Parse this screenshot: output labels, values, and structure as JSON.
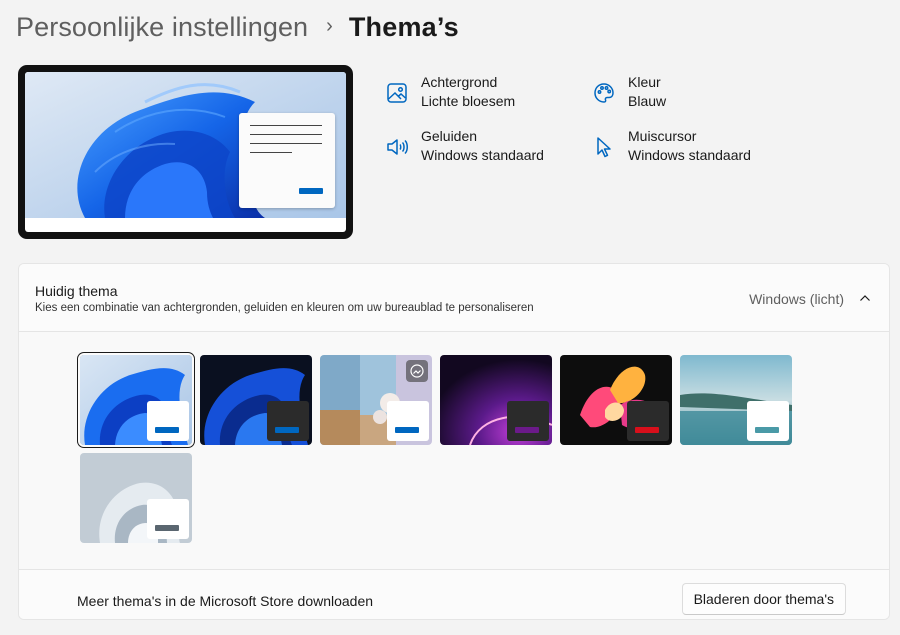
{
  "breadcrumb": {
    "parent": "Persoonlijke instellingen",
    "separator": "›",
    "current": "Thema’s"
  },
  "properties": {
    "background": {
      "title": "Achtergrond",
      "value": "Lichte bloesem",
      "icon": "image-icon"
    },
    "color": {
      "title": "Kleur",
      "value": "Blauw",
      "icon": "palette-icon"
    },
    "sounds": {
      "title": "Geluiden",
      "value": "Windows standaard",
      "icon": "speaker-icon"
    },
    "cursor": {
      "title": "Muiscursor",
      "value": "Windows standaard",
      "icon": "mouse-pointer-icon"
    }
  },
  "current_theme": {
    "title": "Huidig thema",
    "description": "Kies een combinatie van achtergronden, geluiden en kleuren om uw bureaublad te personaliseren",
    "value": "Windows (licht)",
    "expanded": true
  },
  "themes": [
    {
      "id": "windows-light",
      "selected": true,
      "window_color": "#ffffff",
      "button_color": "#0067c0"
    },
    {
      "id": "windows-dark",
      "selected": false,
      "window_color": "#2b2b2b",
      "button_color": "#0067c0"
    },
    {
      "id": "spotlight",
      "selected": false,
      "window_color": "#ffffff",
      "button_color": "#0067c0"
    },
    {
      "id": "glow",
      "selected": false,
      "window_color": "#2b2b2b",
      "button_color": "#6b1a8a"
    },
    {
      "id": "captured-motion",
      "selected": false,
      "window_color": "#2b2b2b",
      "button_color": "#d80f1b"
    },
    {
      "id": "sunrise",
      "selected": false,
      "window_color": "#ffffff",
      "button_color": "#4a9aa7"
    },
    {
      "id": "flow",
      "selected": false,
      "window_color": "#ffffff",
      "button_color": "#5a6670"
    }
  ],
  "footer": {
    "text": "Meer thema's in de Microsoft Store downloaden",
    "button_label": "Bladeren door thema's"
  },
  "colors": {
    "accent": "#0067c0",
    "page_bg": "#f3f3f3",
    "card_bg": "#fbfbfb"
  }
}
